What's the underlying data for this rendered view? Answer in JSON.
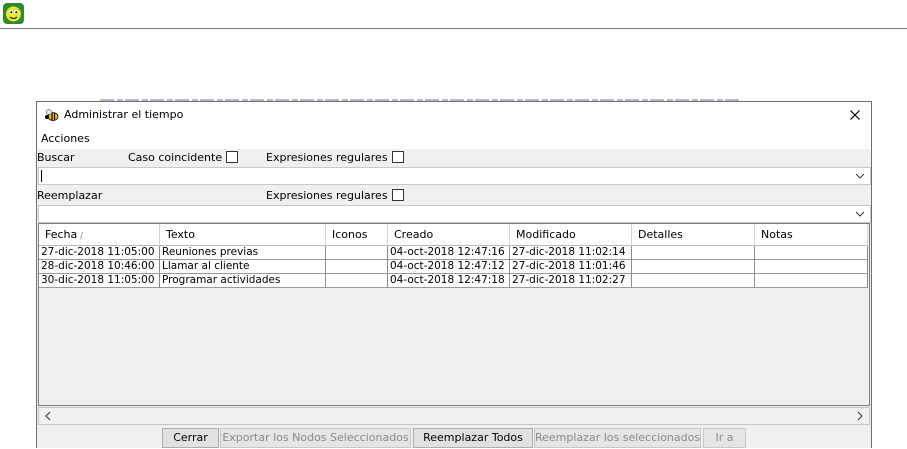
{
  "dialog": {
    "title": "Administrar el tiempo",
    "menu": {
      "actions": "Acciones"
    }
  },
  "search": {
    "label": "Buscar",
    "match_case_label": "Caso coincidente",
    "regex_label": "Expresiones regulares",
    "value": ""
  },
  "replace": {
    "label": "Reemplazar",
    "regex_label": "Expresiones regulares",
    "value": ""
  },
  "table": {
    "columns": [
      "Fecha",
      "Texto",
      "Iconos",
      "Creado",
      "Modificado",
      "Detalles",
      "Notas"
    ],
    "sort_indicator": "∕",
    "rows": [
      {
        "fecha": "27-dic-2018 11:05:00",
        "texto": "Reuniones previas",
        "iconos": "",
        "creado": "04-oct-2018 12:47:16",
        "modificado": "27-dic-2018 11:02:14",
        "detalles": "",
        "notas": ""
      },
      {
        "fecha": "28-dic-2018 10:46:00",
        "texto": "Llamar al cliente",
        "iconos": "",
        "creado": "04-oct-2018 12:47:12",
        "modificado": "27-dic-2018 11:01:46",
        "detalles": "",
        "notas": ""
      },
      {
        "fecha": "30-dic-2018 11:05:00",
        "texto": "Programar actividades",
        "iconos": "",
        "creado": "04-oct-2018 12:47:18",
        "modificado": "27-dic-2018 11:02:27",
        "detalles": "",
        "notas": ""
      }
    ]
  },
  "buttons": {
    "close": "Cerrar",
    "export": "Exportar los Nodos Seleccionados",
    "replace_all": "Reemplazar Todos",
    "replace_selected": "Reemplazar los seleccionados",
    "go_to": "Ir a"
  },
  "icons": {
    "app_logo": "freeplane-logo-icon",
    "dialog_icon": "bee-icon",
    "close": "close-icon",
    "combo_arrow": "chevron-down-icon",
    "scroll_left": "chevron-left-icon",
    "scroll_right": "chevron-right-icon"
  }
}
